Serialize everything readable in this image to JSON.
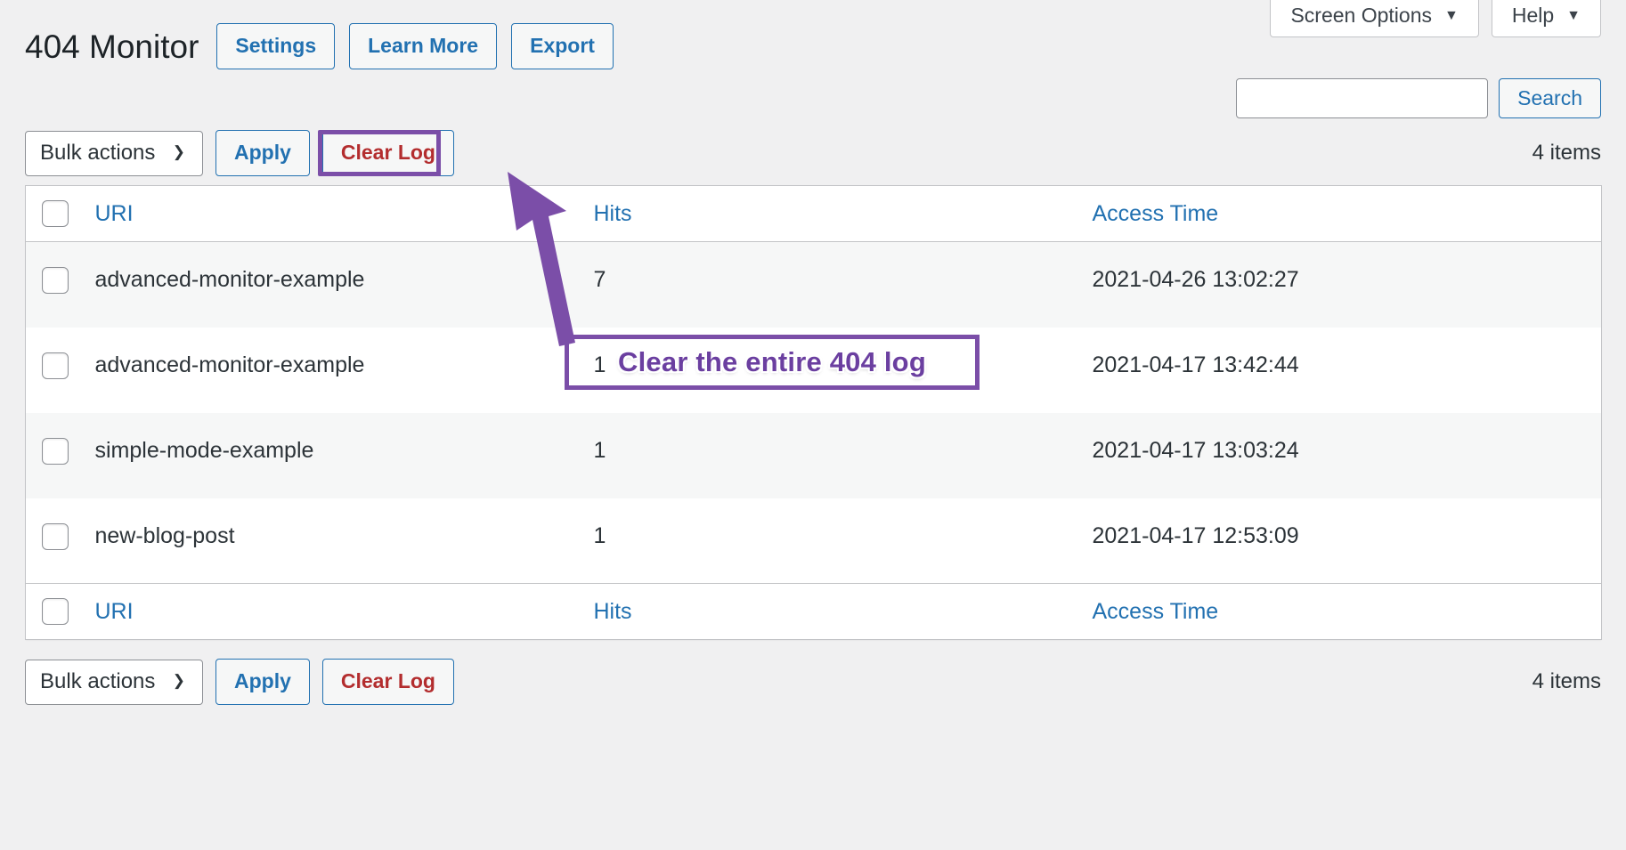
{
  "screen_meta": [
    {
      "label": "Screen Options",
      "icon": "chevron-down-icon"
    },
    {
      "label": "Help",
      "icon": "chevron-down-icon"
    }
  ],
  "header": {
    "title": "404 Monitor",
    "actions": [
      {
        "label": "Settings"
      },
      {
        "label": "Learn More"
      },
      {
        "label": "Export"
      }
    ]
  },
  "search": {
    "value": "",
    "placeholder": "",
    "button_label": "Search"
  },
  "tablenav_top": {
    "bulk_actions_label": "Bulk actions",
    "apply_label": "Apply",
    "clear_log_label": "Clear Log",
    "items_count": "4 items"
  },
  "tablenav_bottom": {
    "bulk_actions_label": "Bulk actions",
    "apply_label": "Apply",
    "clear_log_label": "Clear Log",
    "items_count": "4 items"
  },
  "table": {
    "columns": [
      {
        "key": "cb",
        "label": ""
      },
      {
        "key": "uri",
        "label": "URI"
      },
      {
        "key": "hits",
        "label": "Hits"
      },
      {
        "key": "time",
        "label": "Access Time"
      }
    ],
    "rows": [
      {
        "uri": "advanced-monitor-example",
        "hits": "7",
        "time": "2021-04-26 13:02:27"
      },
      {
        "uri": "advanced-monitor-example",
        "hits": "1",
        "time": "2021-04-17 13:42:44"
      },
      {
        "uri": "simple-mode-example",
        "hits": "1",
        "time": "2021-04-17 13:03:24"
      },
      {
        "uri": "new-blog-post",
        "hits": "1",
        "time": "2021-04-17 12:53:09"
      }
    ]
  },
  "annotation": {
    "callout_text": "Clear the entire 404 log",
    "color": "#7b4ea8"
  },
  "colors": {
    "accent_blue": "#2271b1",
    "danger_red": "#b32d2e",
    "page_bg": "#f0f0f1",
    "row_alt_bg": "#f6f7f7",
    "border": "#c3c4c7",
    "annotation_purple": "#7b4ea8"
  }
}
